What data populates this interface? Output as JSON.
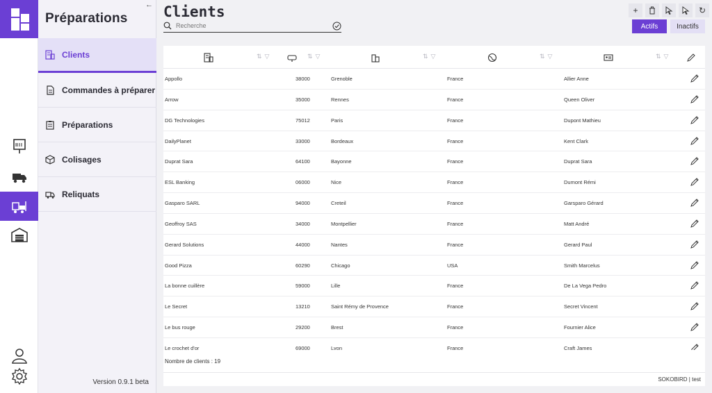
{
  "rail": {
    "items": [
      {
        "name": "barcode-box-icon"
      },
      {
        "name": "truck-icon"
      },
      {
        "name": "forklift-icon",
        "active": true
      },
      {
        "name": "warehouse-icon"
      }
    ],
    "bottom": [
      {
        "name": "user-icon"
      },
      {
        "name": "gear-icon"
      }
    ]
  },
  "nav": {
    "title": "Préparations",
    "collapse": "←",
    "items": [
      {
        "label": "Clients",
        "icon": "building-list-icon",
        "active": true
      },
      {
        "label": "Commandes à préparer",
        "icon": "document-icon"
      },
      {
        "label": "Préparations",
        "icon": "clipboard-icon"
      },
      {
        "label": "Colisages",
        "icon": "package-icon"
      },
      {
        "label": "Reliquats",
        "icon": "delivery-icon"
      }
    ],
    "version": "Version 0.9.1 beta"
  },
  "main": {
    "title": "Clients",
    "search_placeholder": "Recherche",
    "toolbar": [
      "+",
      "🗑",
      "⮞",
      "⮝",
      "↻"
    ],
    "filters": {
      "active": "Actifs",
      "inactive": "Inactifs"
    },
    "columns": [
      {
        "icon": "building-icon"
      },
      {
        "icon": "mailbox-icon"
      },
      {
        "icon": "city-icon"
      },
      {
        "icon": "globe-icon"
      },
      {
        "icon": "id-card-icon"
      }
    ],
    "rows": [
      [
        "Appollo",
        "38000",
        "Grenoble",
        "France",
        "Allier Anne"
      ],
      [
        "Arrow",
        "35000",
        "Rennes",
        "France",
        "Queen Oliver"
      ],
      [
        "DG Technologies",
        "75012",
        "Paris",
        "France",
        "Dupont Mathieu"
      ],
      [
        "DailyPlanet",
        "33000",
        "Bordeaux",
        "France",
        "Kent Clark"
      ],
      [
        "Duprat Sara",
        "64100",
        "Bayonne",
        "France",
        "Duprat Sara"
      ],
      [
        "ESL Banking",
        "06000",
        "Nice",
        "France",
        "Dumont Rémi"
      ],
      [
        "Gasparo SARL",
        "94000",
        "Creteil",
        "France",
        "Garsparo Gérard"
      ],
      [
        "Geoffroy SAS",
        "34000",
        "Montpellier",
        "France",
        "Matt André"
      ],
      [
        "Gerard Solutions",
        "44000",
        "Nantes",
        "France",
        "Gerard Paul"
      ],
      [
        "Good Pizza",
        "60290",
        "Chicago",
        "USA",
        "Smith Marcelus"
      ],
      [
        "La bonne cuillère",
        "59000",
        "Lille",
        "France",
        "De La Vega Pedro"
      ],
      [
        "Le Secret",
        "13210",
        "Saint Rémy de Provence",
        "France",
        "Secret Vincent"
      ],
      [
        "Le bus rouge",
        "29200",
        "Brest",
        "France",
        "Fournier Alice"
      ],
      [
        "Le crochet d'or",
        "69000",
        "Lyon",
        "France",
        "Craft James"
      ]
    ],
    "count_label": "Nombre de clients : 19",
    "status": "SOKOBIRD | test"
  },
  "colors": {
    "accent": "#6b3fd4",
    "accent_light": "#e3dff5"
  }
}
